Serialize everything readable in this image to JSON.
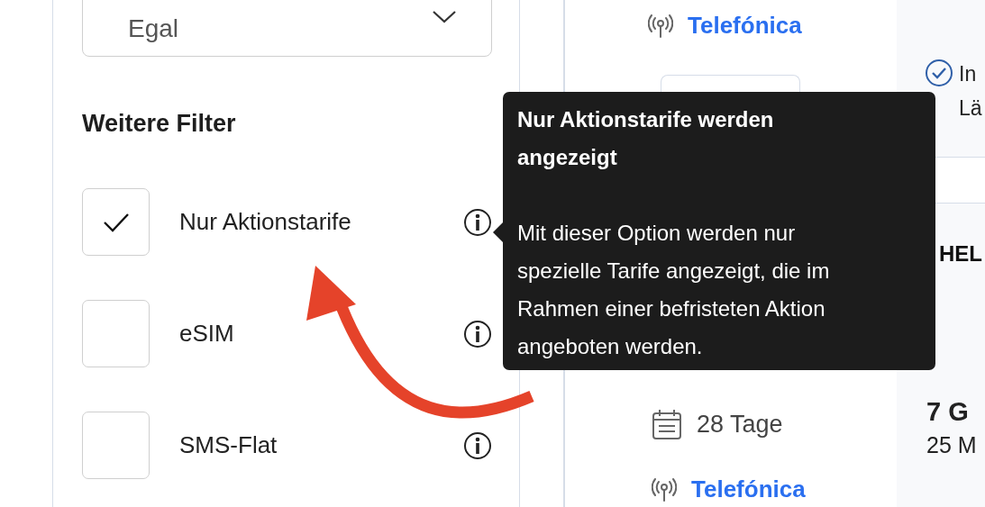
{
  "sidebar": {
    "select": {
      "value": "Egal"
    },
    "heading": "Weitere Filter",
    "filters": [
      {
        "label": "Nur Aktionstarife",
        "checked": true
      },
      {
        "label": "eSIM",
        "checked": false
      },
      {
        "label": "SMS-Flat",
        "checked": false
      }
    ]
  },
  "offer_card": {
    "network_top": "Telefónica",
    "duration": "28 Tage",
    "network_bottom": "Telefónica"
  },
  "side_column": {
    "feature_lines": [
      "In",
      "Lä"
    ],
    "title": "HEL",
    "data_volume": "7 G",
    "minutes": "25 M"
  },
  "tooltip": {
    "title": "Nur Aktionstarife werden angezeigt",
    "text": "Mit dieser Option werden nur spezielle Tarife angezeigt, die im Rahmen einer befristeten Aktion angeboten werden."
  }
}
